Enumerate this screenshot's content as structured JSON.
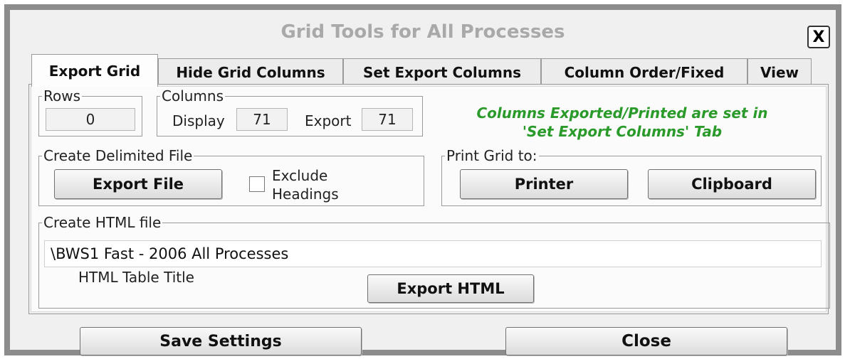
{
  "dialog": {
    "title": "Grid Tools for All Processes",
    "close_x": "X"
  },
  "tabs": [
    {
      "label": "Export Grid",
      "active": true
    },
    {
      "label": "Hide Grid Columns",
      "active": false
    },
    {
      "label": "Set Export Columns",
      "active": false
    },
    {
      "label": "Column Order/Fixed",
      "active": false
    },
    {
      "label": "View",
      "active": false
    }
  ],
  "rows": {
    "legend": "Rows",
    "value": "0"
  },
  "columns": {
    "legend": "Columns",
    "display_label": "Display",
    "display_value": "71",
    "export_label": "Export",
    "export_value": "71"
  },
  "note": {
    "line1": "Columns Exported/Printed are set in",
    "line2": "'Set Export Columns' Tab",
    "color": "#2a9a2a"
  },
  "delimited": {
    "legend": "Create Delimited File",
    "export_button": "Export File",
    "exclude_line1": "Exclude",
    "exclude_line2": "Headings",
    "exclude_checked": false
  },
  "print": {
    "legend": "Print Grid to:",
    "printer_button": "Printer",
    "clipboard_button": "Clipboard"
  },
  "html": {
    "legend": "Create HTML file",
    "path_value": "\\BWS1 Fast - 2006 All Processes",
    "table_title_label": "HTML Table Title",
    "export_button": "Export HTML"
  },
  "footer": {
    "save_button": "Save Settings",
    "close_button": "Close"
  }
}
